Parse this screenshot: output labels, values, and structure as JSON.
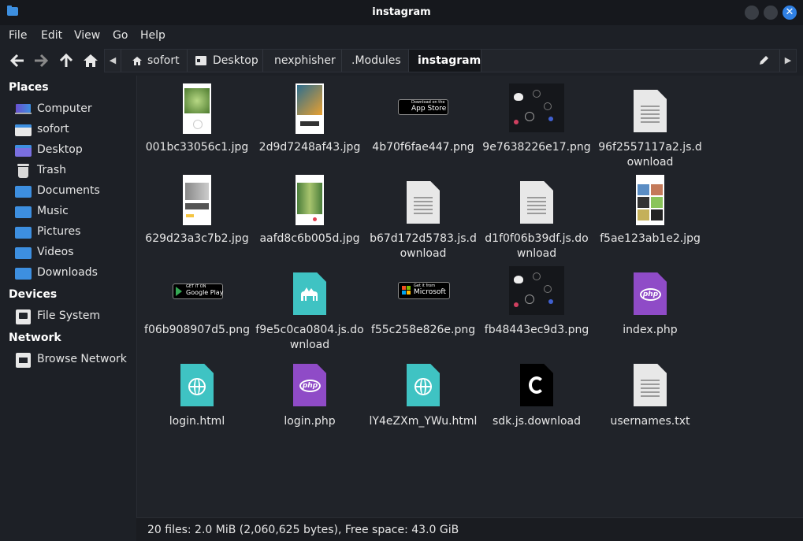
{
  "window": {
    "title": "instagram"
  },
  "menu": [
    "File",
    "Edit",
    "View",
    "Go",
    "Help"
  ],
  "toolbar": {
    "icons": [
      "back-arrow-icon",
      "forward-arrow-icon",
      "up-arrow-icon",
      "home-icon"
    ]
  },
  "pathbar": {
    "crumbs": [
      "sofort",
      "Desktop",
      "nexphisher",
      ".Modules",
      "instagram"
    ],
    "active": "instagram"
  },
  "sidebar": {
    "places_header": "Places",
    "places": [
      "Computer",
      "sofort",
      "Desktop",
      "Trash",
      "Documents",
      "Music",
      "Pictures",
      "Videos",
      "Downloads"
    ],
    "devices_header": "Devices",
    "devices": [
      "File System"
    ],
    "network_header": "Network",
    "network": [
      "Browse Network"
    ]
  },
  "files": [
    "001bc33056c1.jpg",
    "2d9d7248af43.jpg",
    "4b70f6fae447.png",
    "9e7638226e17.png",
    "96f2557117a2.js.download",
    "629d23a3c7b2.jpg",
    "aafd8c6b005d.jpg",
    "b67d172d5783.js.download",
    "d1f0f06b39df.js.download",
    "f5ae123ab1e2.jpg",
    "f06b908907d5.png",
    "f9e5c0ca0804.js.download",
    "f55c258e826e.png",
    "fb48443ec9d3.png",
    "index.php",
    "login.html",
    "login.php",
    "lY4eZXm_YWu.html",
    "sdk.js.download",
    "usernames.txt"
  ],
  "badges": {
    "appstore_small": "Download on the",
    "appstore": "App Store",
    "googleplay_small": "GET IT ON",
    "googleplay": "Google Play",
    "microsoft_small": "Get it from",
    "microsoft": "Microsoft"
  },
  "status": "20 files: 2.0 MiB (2,060,625 bytes), Free space: 43.0 GiB"
}
